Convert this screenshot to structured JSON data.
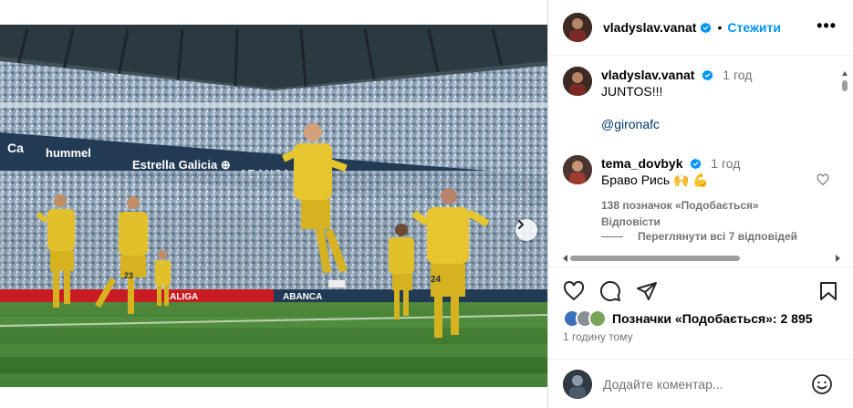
{
  "header": {
    "username": "vladyslav.vanat",
    "separator": "•",
    "follow_label": "Стежити",
    "more_label": "•••"
  },
  "comments": [
    {
      "username": "vladyslav.vanat",
      "time": "1 год",
      "text": "JUNTOS!!!",
      "mention": "@gironafc"
    },
    {
      "username": "tema_dovbyk",
      "time": "1 год",
      "text": "Браво Рись 🙌 💪",
      "likes_label": "138 позначок «Подобається»",
      "reply_label": "Відповісти"
    }
  ],
  "view_replies": "Переглянути всі 7 відповідей",
  "likes": {
    "label": "Позначки «Подобається»: 2 895"
  },
  "posted_ago": "1 годину тому",
  "add_comment": {
    "placeholder": "Додайте коментар..."
  },
  "carousel": {
    "slides": 5,
    "active": 0
  },
  "icons": {
    "like": "heart-icon",
    "comment": "comment-icon",
    "share": "send-icon",
    "save": "bookmark-icon",
    "emoji": "emoji-icon",
    "next": "chevron-right-icon",
    "verified": "verified-badge-icon"
  },
  "colors": {
    "link_blue": "#0095f6",
    "mention": "#00376b",
    "muted": "#737373",
    "verified": "#0095f6"
  }
}
